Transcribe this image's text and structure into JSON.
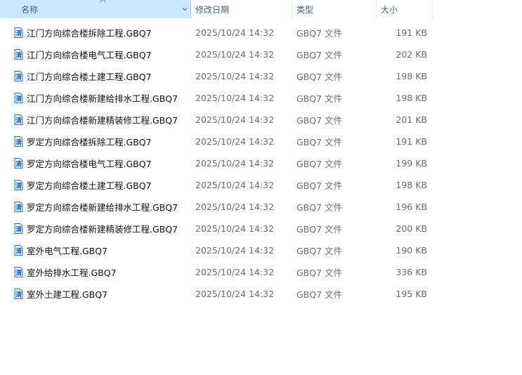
{
  "columns": {
    "name": "名称",
    "date": "修改日期",
    "type": "类型",
    "size": "大小"
  },
  "file_icon_glyph": "清",
  "files": [
    {
      "name": "江门方向综合楼拆除工程.GBQ7",
      "date": "2025/10/24 14:32",
      "type": "GBQ7 文件",
      "size": "191 KB"
    },
    {
      "name": "江门方向综合楼电气工程.GBQ7",
      "date": "2025/10/24 14:32",
      "type": "GBQ7 文件",
      "size": "202 KB"
    },
    {
      "name": "江门方向综合楼土建工程.GBQ7",
      "date": "2025/10/24 14:32",
      "type": "GBQ7 文件",
      "size": "198 KB"
    },
    {
      "name": "江门方向综合楼新建给排水工程.GBQ7",
      "date": "2025/10/24 14:32",
      "type": "GBQ7 文件",
      "size": "198 KB"
    },
    {
      "name": "江门方向综合楼新建精装修工程.GBQ7",
      "date": "2025/10/24 14:32",
      "type": "GBQ7 文件",
      "size": "201 KB"
    },
    {
      "name": "罗定方向综合楼拆除工程.GBQ7",
      "date": "2025/10/24 14:32",
      "type": "GBQ7 文件",
      "size": "191 KB"
    },
    {
      "name": "罗定方向综合楼电气工程.GBQ7",
      "date": "2025/10/24 14:32",
      "type": "GBQ7 文件",
      "size": "199 KB"
    },
    {
      "name": "罗定方向综合楼土建工程.GBQ7",
      "date": "2025/10/24 14:32",
      "type": "GBQ7 文件",
      "size": "198 KB"
    },
    {
      "name": "罗定方向综合楼新建给排水工程.GBQ7",
      "date": "2025/10/24 14:32",
      "type": "GBQ7 文件",
      "size": "196 KB"
    },
    {
      "name": "罗定方向综合楼新建精装修工程.GBQ7",
      "date": "2025/10/24 14:32",
      "type": "GBQ7 文件",
      "size": "200 KB"
    },
    {
      "name": "室外电气工程.GBQ7",
      "date": "2025/10/24 14:32",
      "type": "GBQ7 文件",
      "size": "190 KB"
    },
    {
      "name": "室外给排水工程.GBQ7",
      "date": "2025/10/24 14:32",
      "type": "GBQ7 文件",
      "size": "336 KB"
    },
    {
      "name": "室外土建工程.GBQ7",
      "date": "2025/10/24 14:32",
      "type": "GBQ7 文件",
      "size": "195 KB"
    }
  ],
  "colors": {
    "header_selected_bg": "#cce8ff",
    "icon_blue": "#1f6fd1"
  }
}
